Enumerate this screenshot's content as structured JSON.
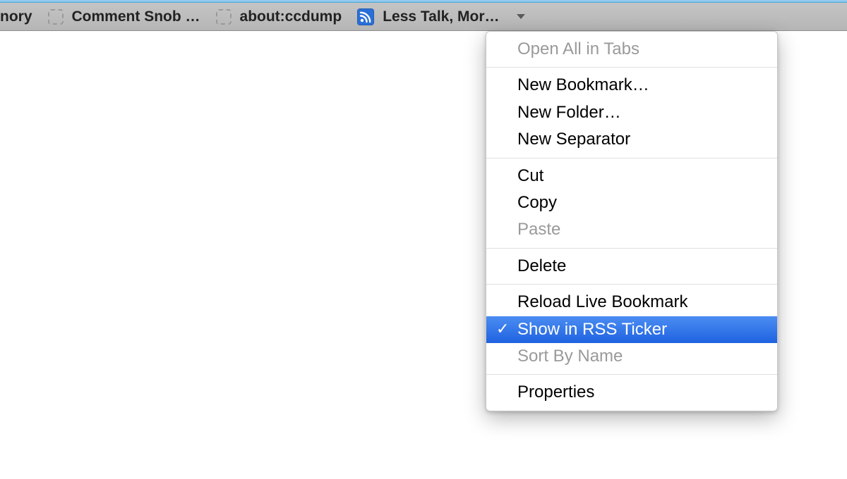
{
  "bookmarks_bar": {
    "items": [
      {
        "label": "nory",
        "icon": "none"
      },
      {
        "label": "Comment Snob …",
        "icon": "placeholder"
      },
      {
        "label": "about:ccdump",
        "icon": "placeholder"
      },
      {
        "label": "Less Talk, Mor…",
        "icon": "rss"
      }
    ]
  },
  "context_menu": {
    "groups": [
      [
        {
          "label": "Open All in Tabs",
          "disabled": true
        }
      ],
      [
        {
          "label": "New Bookmark…"
        },
        {
          "label": "New Folder…"
        },
        {
          "label": "New Separator"
        }
      ],
      [
        {
          "label": "Cut"
        },
        {
          "label": "Copy"
        },
        {
          "label": "Paste",
          "disabled": true
        }
      ],
      [
        {
          "label": "Delete"
        }
      ],
      [
        {
          "label": "Reload Live Bookmark"
        },
        {
          "label": "Show in RSS Ticker",
          "checked": true,
          "highlight": true
        },
        {
          "label": "Sort By Name",
          "disabled": true
        }
      ],
      [
        {
          "label": "Properties"
        }
      ]
    ]
  }
}
